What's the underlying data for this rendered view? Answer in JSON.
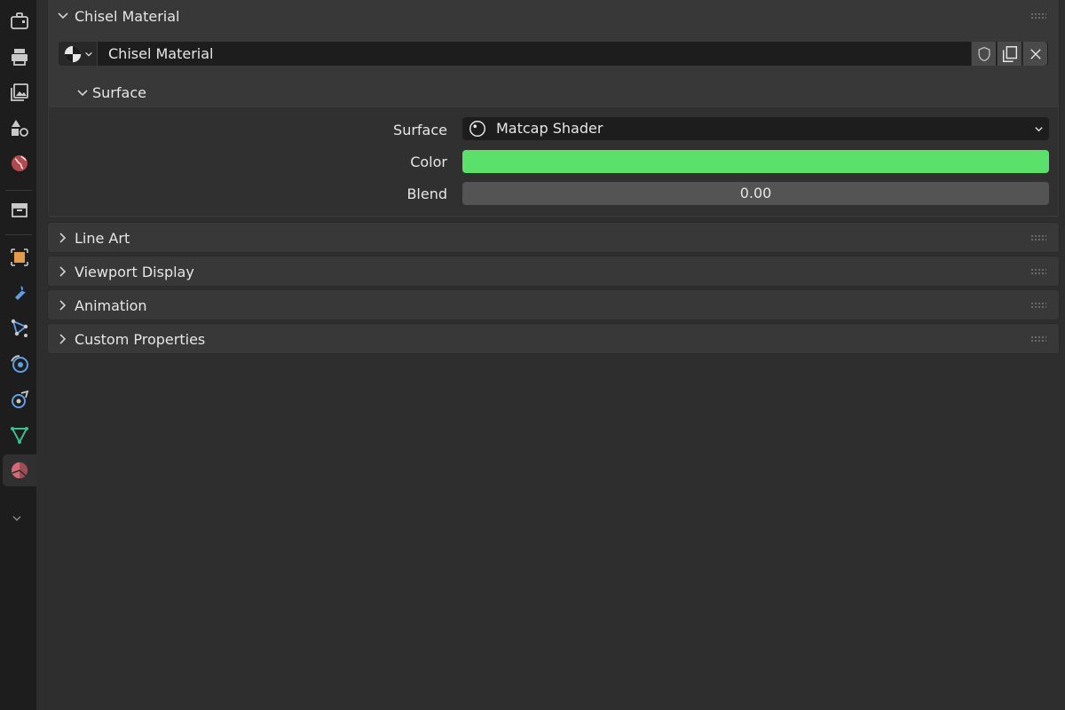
{
  "sidebar": {
    "tabs": [
      {
        "name": "tool-icon",
        "active": false
      },
      {
        "name": "render-icon",
        "active": false
      },
      {
        "name": "output-icon",
        "active": false
      },
      {
        "name": "view-layer-icon",
        "active": false
      },
      {
        "name": "scene-icon",
        "active": false
      },
      {
        "name": "world-icon",
        "active": false
      },
      {
        "name": "collection-icon",
        "active": false
      },
      {
        "name": "object-icon",
        "active": false
      },
      {
        "name": "modifiers-icon",
        "active": false
      },
      {
        "name": "particles-icon",
        "active": false
      },
      {
        "name": "physics-icon",
        "active": false
      },
      {
        "name": "constraints-icon",
        "active": false
      },
      {
        "name": "data-icon",
        "active": false
      },
      {
        "name": "material-icon",
        "active": true
      }
    ],
    "more_icon": "chevron-down-icon"
  },
  "material_panel": {
    "title": "Chisel Material",
    "material_name": "Chisel Material",
    "surface_section": {
      "title": "Surface",
      "rows": {
        "surface_label": "Surface",
        "surface_value": "Matcap Shader",
        "color_label": "Color",
        "color_value": "#59e16b",
        "blend_label": "Blend",
        "blend_value": "0.00"
      }
    }
  },
  "collapsed_panels": [
    {
      "title": "Line Art"
    },
    {
      "title": "Viewport Display"
    },
    {
      "title": "Animation"
    },
    {
      "title": "Custom Properties"
    }
  ],
  "colors": {
    "background": "#2e2e2e",
    "panel": "#383838",
    "sidebar": "#1d1d1d",
    "field_dark": "#1d1d1d",
    "color_swatch": "#59e16b",
    "blend_field": "#545454"
  }
}
